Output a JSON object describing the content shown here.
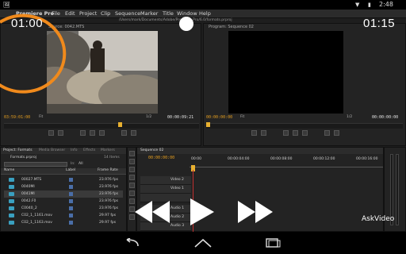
{
  "system": {
    "time": "2:48",
    "battery_icon": "battery-icon",
    "wifi_icon": "wifi-icon"
  },
  "menu": {
    "app": "Premiere Pro",
    "items": [
      "File",
      "Edit",
      "Project",
      "Clip",
      "Sequence",
      "Marker",
      "Title",
      "Window",
      "Help"
    ]
  },
  "path": "/Users/mark/Documents/Adobe/Premiere Pro/6.0/formats.prproj",
  "overlay": {
    "left_timer": "01:00",
    "right_timer": "01:15"
  },
  "source": {
    "title": "Source: 0042.MTS",
    "timecode_left": "03:59:01:00",
    "fit_label": "Fit",
    "ratio": "1/2",
    "timecode_right": "00:00:09:21"
  },
  "program": {
    "title": "Program: Sequence 02",
    "timecode_left": "00:00:00:00",
    "fit_label": "Fit",
    "ratio": "1/2",
    "timecode_right": "00:00:00:00"
  },
  "project": {
    "tabs": [
      "Project: Formats",
      "Media Browser",
      "Info",
      "Effects",
      "Markers"
    ],
    "file": "Formats.prproj",
    "count": "14 Items",
    "search_label": "In:",
    "search_value": "All",
    "headers": {
      "name": "Name",
      "label": "Label",
      "frame_rate": "Frame Rate"
    },
    "rows": [
      {
        "name": "00027.MTS",
        "fps": "23.976 fps"
      },
      {
        "name": "0040MI",
        "fps": "23.976 fps"
      },
      {
        "name": "0041MI",
        "fps": "23.976 fps"
      },
      {
        "name": "0042.F0",
        "fps": "23.976 fps"
      },
      {
        "name": "C0040_2",
        "fps": "23.976 fps"
      },
      {
        "name": "C02_1_1161.mov",
        "fps": "29.97 fps"
      },
      {
        "name": "C02_1_1163.mov",
        "fps": "29.97 fps"
      }
    ]
  },
  "timeline": {
    "tab": "Sequence 02",
    "timecode": "00:00:00:00",
    "ruler": [
      "00:00",
      "00:00:04:00",
      "00:00:08:00",
      "00:00:12:00",
      "00:00:16:00"
    ],
    "tracks": [
      "Video 2",
      "Video 1",
      "Audio 1",
      "Audio 2",
      "Audio 3"
    ]
  },
  "watermark": "AskVideo",
  "player": {
    "rewind_icon": "rewind-icon",
    "play_icon": "play-icon",
    "forward_icon": "fast-forward-icon"
  },
  "nav": {
    "back_icon": "back-icon",
    "home_icon": "home-icon",
    "recents_icon": "recents-icon"
  }
}
